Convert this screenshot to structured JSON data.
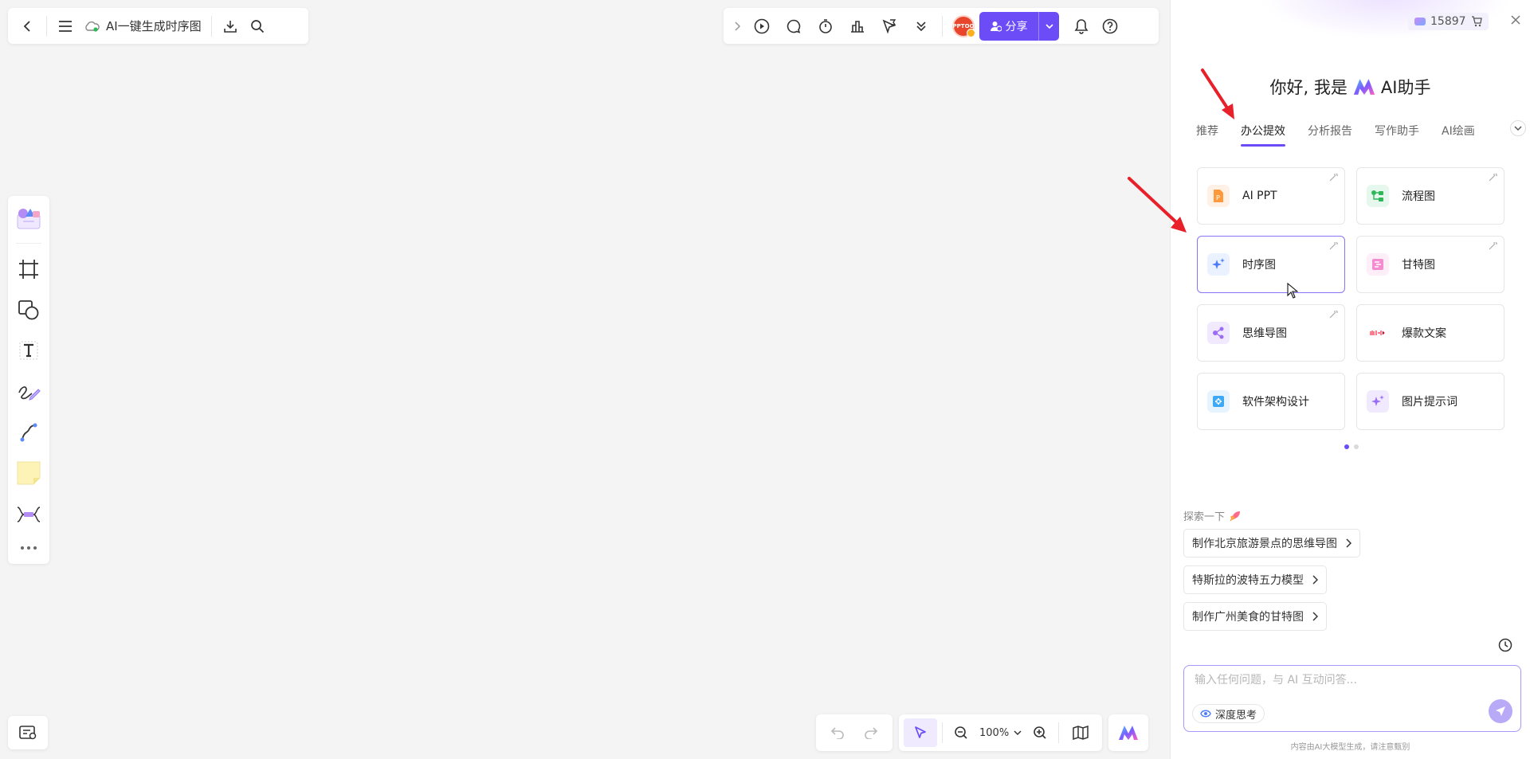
{
  "document": {
    "title": "AI一键生成时序图"
  },
  "topbar_right": {
    "avatar_text": "PPTOO",
    "share_label": "分享"
  },
  "zoom": {
    "level": "100%"
  },
  "ai_panel": {
    "credits": "15897",
    "greeting_prefix": "你好, 我是",
    "greeting_suffix": "AI助手",
    "tabs": [
      {
        "label": "推荐",
        "active": false
      },
      {
        "label": "办公提效",
        "active": true
      },
      {
        "label": "分析报告",
        "active": false
      },
      {
        "label": "写作助手",
        "active": false
      },
      {
        "label": "AI绘画",
        "active": false
      }
    ],
    "cards": [
      {
        "label": "AI PPT"
      },
      {
        "label": "流程图"
      },
      {
        "label": "时序图"
      },
      {
        "label": "甘特图"
      },
      {
        "label": "思维导图"
      },
      {
        "label": "爆款文案"
      },
      {
        "label": "软件架构设计"
      },
      {
        "label": "图片提示词"
      }
    ],
    "explore_title": "探索一下",
    "suggestions": [
      "制作北京旅游景点的思维导图",
      "特斯拉的波特五力模型",
      "制作广州美食的甘特图"
    ],
    "input_placeholder": "输入任何问题，与 AI 互动问答...",
    "deep_think_label": "深度思考",
    "disclaimer": "内容由AI大模型生成，请注意甄别"
  },
  "colors": {
    "accent": "#6b4cf6",
    "selected_border": "#8a73f7"
  }
}
